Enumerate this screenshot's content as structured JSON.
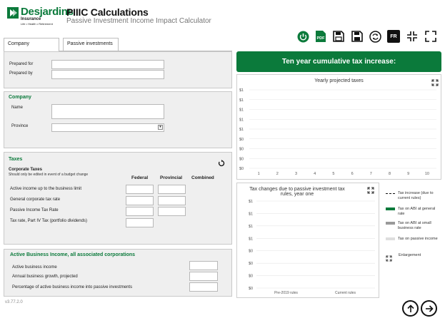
{
  "header": {
    "brand": "Desjardins",
    "brand_sub": "Insurance",
    "brand_tagline": "Life • Health • Retirement",
    "title": "PIIIC Calculations",
    "subtitle": "Passive Investment Income Impact Calculator"
  },
  "toolbar": {
    "lang_label": "FR",
    "pdf_label": "PDF"
  },
  "tabs": [
    {
      "label": "Company",
      "active": true
    },
    {
      "label": "Passive investments",
      "active": false
    }
  ],
  "prepared": {
    "prepared_for_label": "Prepared for",
    "prepared_for_value": "",
    "prepared_by_label": "Prepared by",
    "prepared_by_value": ""
  },
  "company": {
    "title": "Company",
    "name_label": "Name",
    "name_value": "",
    "province_label": "Province",
    "province_value": ""
  },
  "taxes": {
    "title": "Taxes",
    "corporate_label": "Corporate Taxes",
    "corporate_note": "Should only be edited in event of a budget change",
    "col_federal": "Federal",
    "col_provincial": "Provincial",
    "col_combined": "Combined",
    "rows": [
      {
        "label": "Active income up to the business limit"
      },
      {
        "label": "General corporate tax rate"
      },
      {
        "label": "Passive Income Tax Rate"
      },
      {
        "label": "Tax rate, Part IV Tax (portfolio dividends)"
      }
    ]
  },
  "abi": {
    "title": "Active Business Income, all associated corporations",
    "rows": [
      {
        "label": "Active business income",
        "value": ""
      },
      {
        "label": "Annual business growth, projected",
        "value": ""
      },
      {
        "label": "Percentage of active business income into passive investments",
        "value": ""
      }
    ]
  },
  "summary_bar": "Ten year cumulative tax increase:",
  "chart_data": [
    {
      "type": "line",
      "title": "Yearly projected taxes",
      "x": [
        1,
        2,
        3,
        4,
        5,
        6,
        7,
        8,
        9,
        10
      ],
      "y_ticks": [
        "$1",
        "$1",
        "$1",
        "$1",
        "$1",
        "$0",
        "$0",
        "$0",
        "$0"
      ],
      "series": []
    },
    {
      "type": "bar",
      "title": "Tax changes due to passive investment tax rules, year one",
      "categories": [
        "Pre-2019 rules",
        "Current rules"
      ],
      "y_ticks": [
        "$1",
        "$1",
        "$1",
        "$1",
        "$0",
        "$0",
        "$0",
        "$0"
      ],
      "series": []
    }
  ],
  "legend": [
    {
      "label": "Tax increase (due to current rules)",
      "color": "#111111",
      "style": "dashed"
    },
    {
      "label": "Tax on ABI at general rate",
      "color": "#0b7a3b",
      "style": "solid"
    },
    {
      "label": "Tax on ABI at small business rate",
      "color": "#9a9a9a",
      "style": "solid"
    },
    {
      "label": "Tax on passive income",
      "color": "#dedede",
      "style": "solid"
    },
    {
      "label": "Enlargement",
      "icon": "expand-icon"
    }
  ],
  "version": "v3.77.2.0",
  "colors": {
    "brand": "#0b7a3b",
    "panel": "#efefef"
  }
}
